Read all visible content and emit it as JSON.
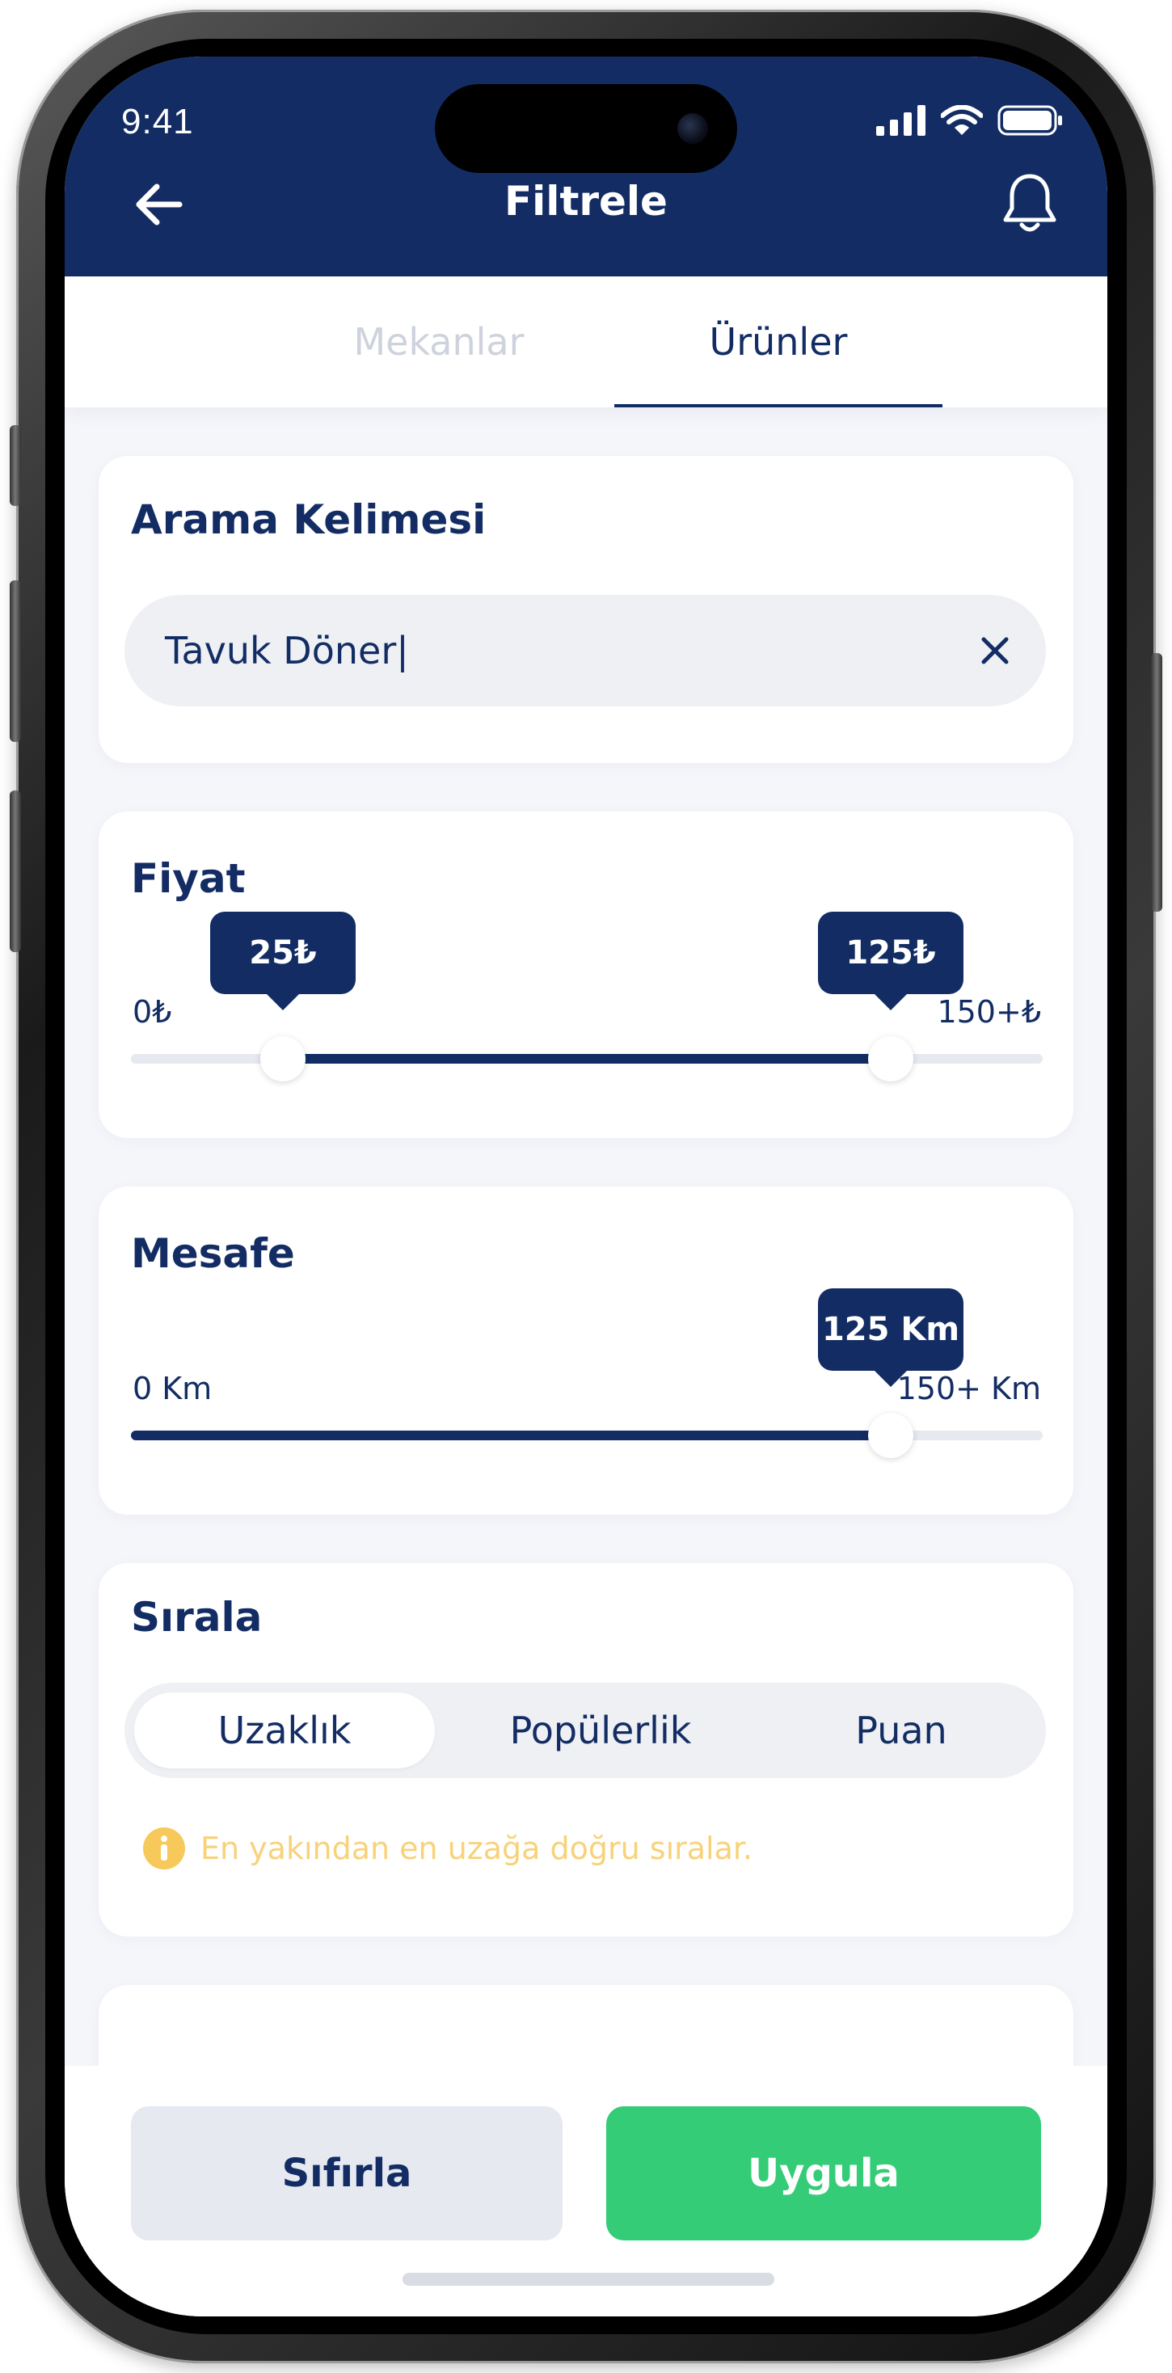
{
  "status_bar": {
    "time": "9:41"
  },
  "header": {
    "title": "Filtrele",
    "back_icon": "arrow-left-icon",
    "bell_icon": "bell-icon"
  },
  "tabs": [
    {
      "label": "Mekanlar",
      "active": false
    },
    {
      "label": "Ürünler",
      "active": true
    }
  ],
  "search": {
    "title": "Arama Kelimesi",
    "value": "Tavuk Döner|",
    "clear_icon": "close-icon"
  },
  "price": {
    "title": "Fiyat",
    "min_label": "0₺",
    "max_label": "150+₺",
    "min": 0,
    "max": 150,
    "low": 25,
    "high": 125,
    "low_label": "25₺",
    "high_label": "125₺"
  },
  "distance": {
    "title": "Mesafe",
    "min_label": "0 Km",
    "max_label": "150+ Km",
    "min": 0,
    "max": 150,
    "value": 125,
    "value_label": "125 Km"
  },
  "sort": {
    "title": "Sırala",
    "options": [
      "Uzaklık",
      "Popülerlik",
      "Puan"
    ],
    "selected": "Uzaklık",
    "info": "En yakından en uzağa doğru sıralar."
  },
  "actions": {
    "reset": "Sıfırla",
    "apply": "Uygula"
  },
  "colors": {
    "navy": "#132d64",
    "green": "#34cc77",
    "warning": "#f7b733"
  }
}
